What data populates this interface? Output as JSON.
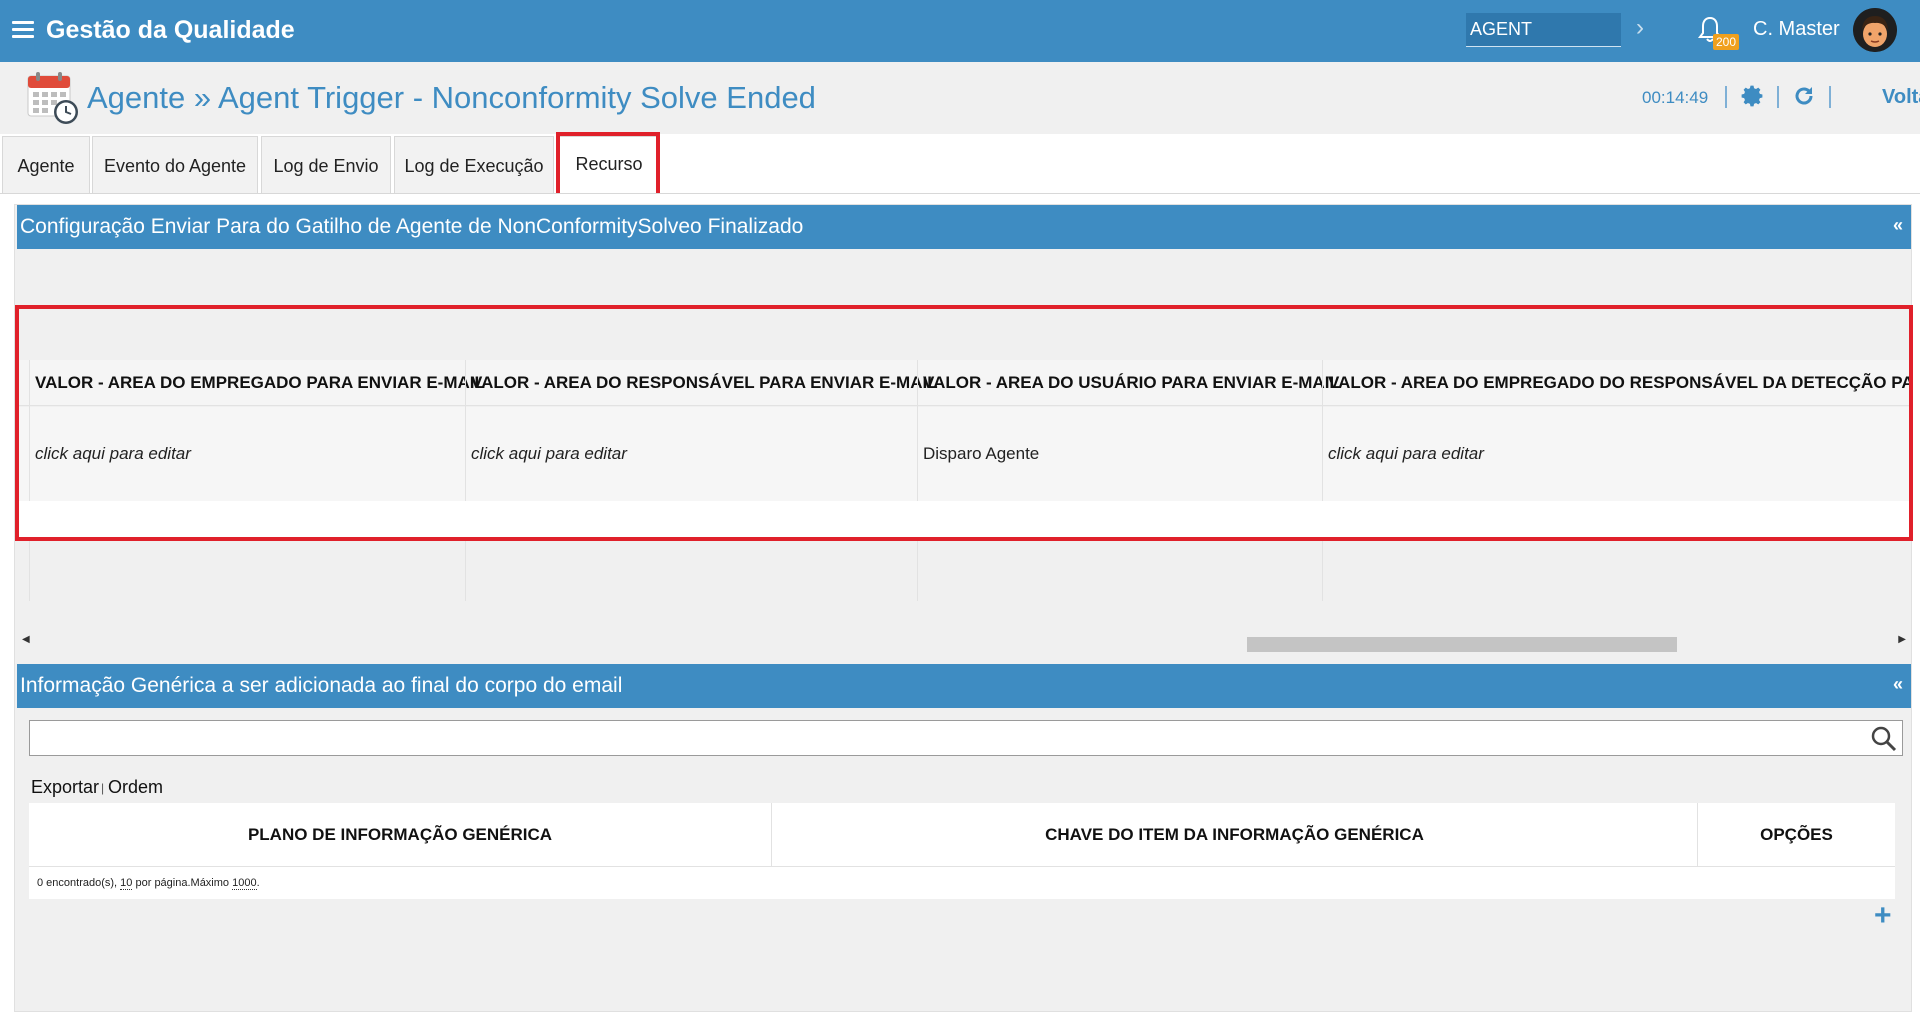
{
  "topbar": {
    "app_title": "Gestão da Qualidade",
    "agent_select_value": "AGENT",
    "notification_count": "200",
    "user_name": "C. Master"
  },
  "header": {
    "title": "Agente » Agent Trigger - Nonconformity Solve Ended",
    "timer": "00:14:49",
    "back_label": "Voltar"
  },
  "tabs": [
    {
      "label": "Agente"
    },
    {
      "label": "Evento do Agente"
    },
    {
      "label": "Log de Envio"
    },
    {
      "label": "Log de Execução"
    },
    {
      "label": "Recurso",
      "active": true
    }
  ],
  "config_panel": {
    "title": "Configuração Enviar Para do Gatilho de Agente de NonConformitySolveo Finalizado",
    "collapse_label": "«",
    "columns": [
      "VALOR - AREA DO EMPREGADO PARA ENVIAR E-MAIL",
      "VALOR - AREA DO RESPONSÁVEL PARA ENVIAR E-MAIL",
      "VALOR - AREA DO USUÁRIO PARA ENVIAR E-MAIL",
      "VALOR - AREA DO EMPREGADO DO RESPONSÁVEL DA DETECÇÃO PARA ENVIAR E-MAIL"
    ],
    "row": [
      "click aqui para editar",
      "click aqui para editar",
      "Disparo Agente",
      "click aqui para editar"
    ]
  },
  "generic_panel": {
    "title": "Informação Genérica a ser adicionada ao final do corpo do email",
    "collapse_label": "«",
    "search_value": "",
    "export_label": "Exportar",
    "order_label": "Ordem",
    "columns": [
      "PLANO DE INFORMAÇÃO GENÉRICA",
      "CHAVE DO ITEM DA INFORMAÇÃO GENÉRICA",
      "OPÇÕES"
    ],
    "footer": {
      "found": "0 encontrado(s),",
      "per_page": "10",
      "per_page_label": "por página.Máximo",
      "max": "1000",
      "end": "."
    },
    "add_label": "+"
  },
  "colors": {
    "accent": "#3e8cc2",
    "highlight": "#e0202a",
    "badge": "#f0a01e"
  }
}
